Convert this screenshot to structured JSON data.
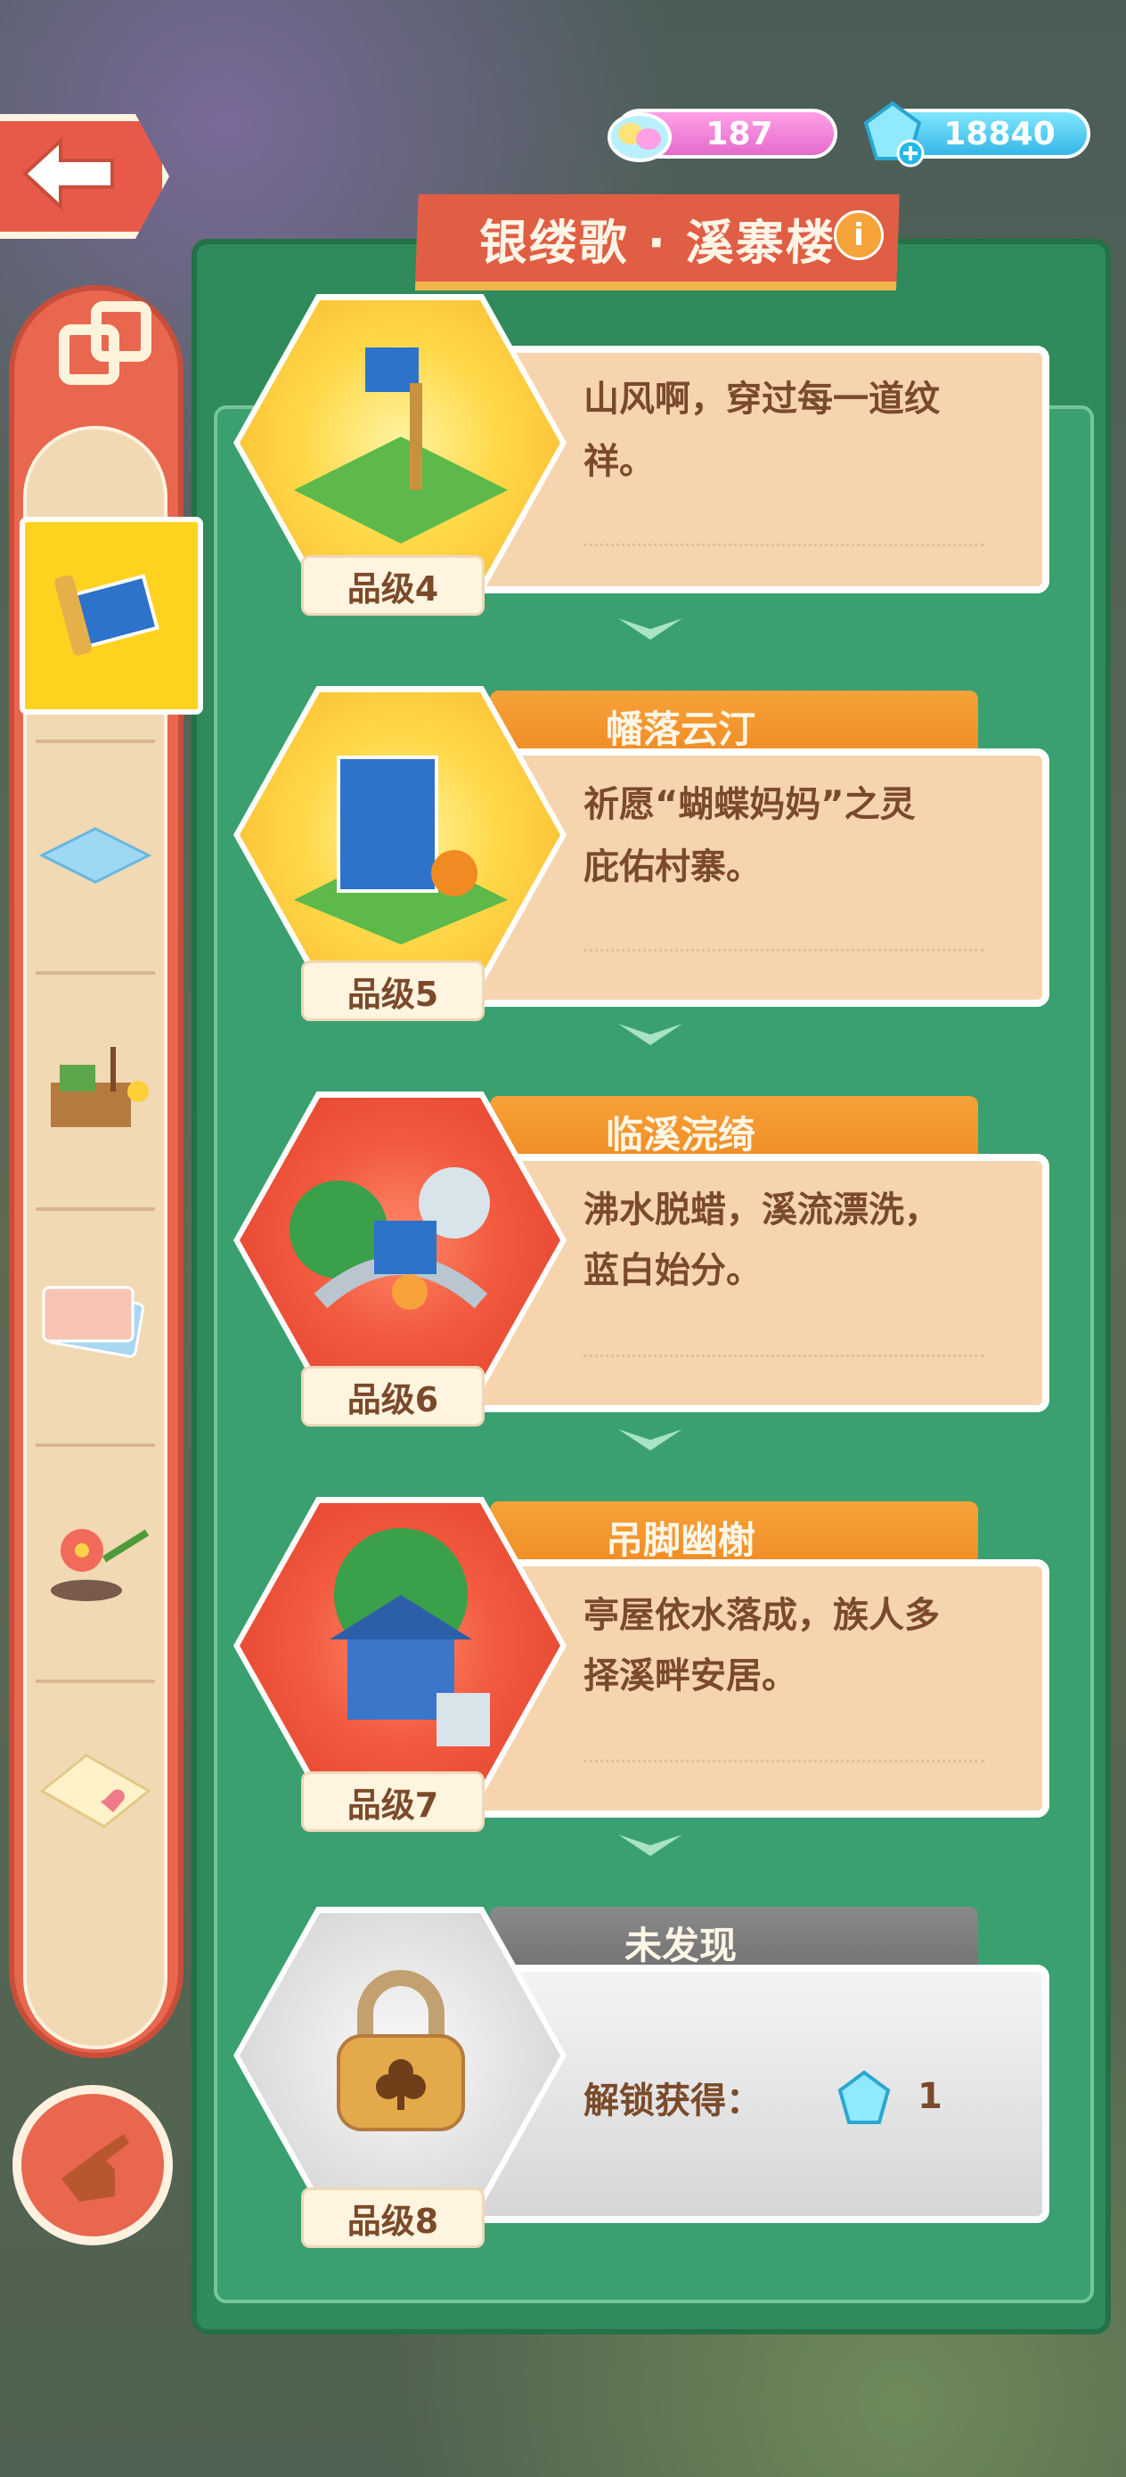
{
  "header": {
    "title": "银缕歌 · 溪寨楼",
    "currency": {
      "rainbow": "187",
      "gems": "18840"
    }
  },
  "tiers": [
    {
      "tier": "品级4",
      "desc_line1": "山风啊，穿过每一道纹",
      "desc_line2": "祥。"
    },
    {
      "tier": "品级5",
      "name": "幡落云汀",
      "desc_line1": "祈愿“蝴蝶妈妈”之灵",
      "desc_line2": "庇佑村寨。"
    },
    {
      "tier": "品级6",
      "name": "临溪浣绮",
      "desc_line1": "沸水脱蜡，溪流漂洗，",
      "desc_line2": "蓝白始分。"
    },
    {
      "tier": "品级7",
      "name": "吊脚幽榭",
      "desc_line1": "亭屋依水落成，族人多",
      "desc_line2": "择溪畔安居。"
    },
    {
      "tier": "品级8",
      "name": "未发现",
      "unlock_label": "解锁获得：",
      "unlock_count": "1"
    }
  ],
  "colors": {
    "accent": "#e05e44",
    "panel": "#2f8a5c",
    "card": "#f6d5ae",
    "tab": "#f7a23a"
  }
}
